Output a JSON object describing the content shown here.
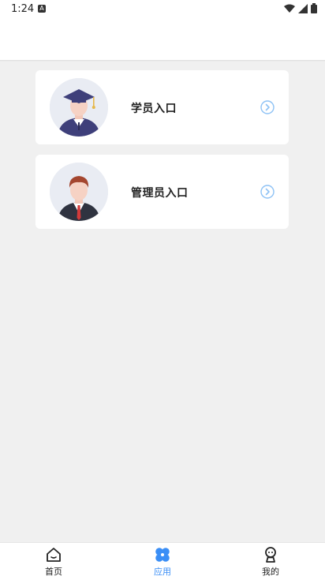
{
  "status_bar": {
    "time": "1:24",
    "a_badge": "A"
  },
  "entries": [
    {
      "label": "学员入口",
      "icon": "graduate-avatar"
    },
    {
      "label": "管理员入口",
      "icon": "admin-avatar"
    }
  ],
  "bottom_nav": {
    "items": [
      {
        "label": "首页",
        "icon": "home-icon"
      },
      {
        "label": "应用",
        "icon": "apps-icon",
        "active": true
      },
      {
        "label": "我的",
        "icon": "profile-icon"
      }
    ],
    "active_color": "#3a8ef6"
  }
}
